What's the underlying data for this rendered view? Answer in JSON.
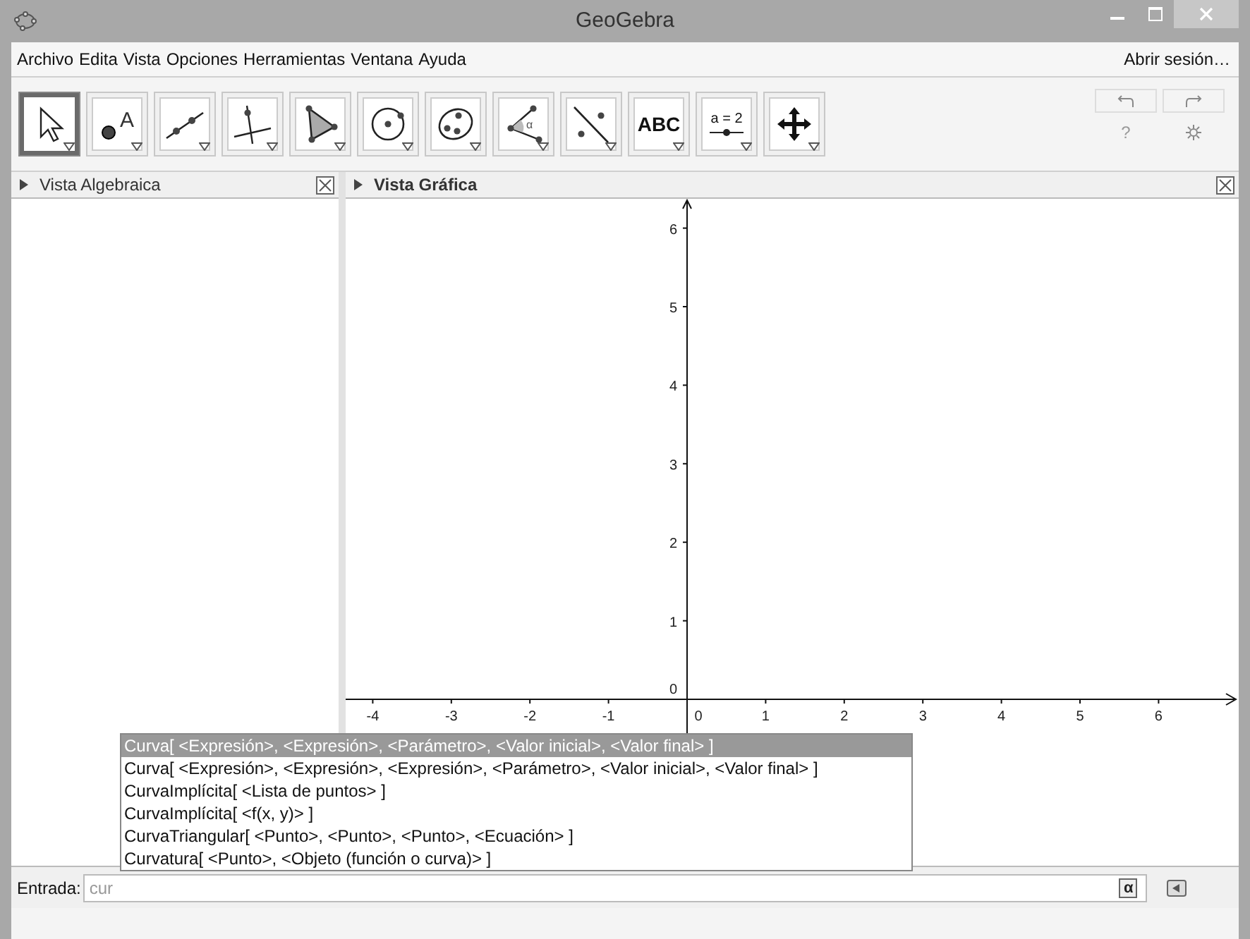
{
  "window": {
    "title": "GeoGebra"
  },
  "menu": [
    "Archivo",
    "Edita",
    "Vista",
    "Opciones",
    "Herramientas",
    "Ventana",
    "Ayuda"
  ],
  "sign_in": "Abrir sesión…",
  "tools": [
    {
      "kind": "move",
      "selected": true
    },
    {
      "kind": "point",
      "label": "A",
      "selected": false
    },
    {
      "kind": "line",
      "selected": false
    },
    {
      "kind": "perpendicular",
      "selected": false
    },
    {
      "kind": "polygon",
      "selected": false
    },
    {
      "kind": "circle",
      "selected": false
    },
    {
      "kind": "conic",
      "selected": false
    },
    {
      "kind": "angle",
      "label": "α",
      "selected": false
    },
    {
      "kind": "reflect",
      "selected": false
    },
    {
      "kind": "text",
      "label": "ABC",
      "selected": false
    },
    {
      "kind": "slider",
      "label": "a = 2",
      "selected": false
    },
    {
      "kind": "pan",
      "selected": false
    }
  ],
  "help": "?",
  "algebra_view": {
    "title": "Vista Algebraica"
  },
  "graphics_view": {
    "title": "Vista Gráfica",
    "x_labels": [
      "-4",
      "-3",
      "-2",
      "-1",
      "0",
      "1",
      "2",
      "3",
      "4",
      "5",
      "6"
    ],
    "y_labels": [
      "6",
      "5",
      "4",
      "3",
      "2",
      "1",
      "0"
    ]
  },
  "suggestions": [
    {
      "text": "Curva[ <Expresión>, <Expresión>, <Parámetro>, <Valor inicial>, <Valor final> ]",
      "selected": true
    },
    {
      "text": "Curva[ <Expresión>, <Expresión>, <Expresión>, <Parámetro>, <Valor inicial>, <Valor final> ]",
      "selected": false
    },
    {
      "text": "CurvaImplícita[ <Lista de puntos> ]",
      "selected": false
    },
    {
      "text": "CurvaImplícita[ <f(x, y)> ]",
      "selected": false
    },
    {
      "text": "CurvaTriangular[ <Punto>, <Punto>, <Punto>, <Ecuación> ]",
      "selected": false
    },
    {
      "text": "Curvatura[ <Punto>, <Objeto (función o curva)> ]",
      "selected": false
    }
  ],
  "input_bar": {
    "label": "Entrada:",
    "value": "cur",
    "symbol": "α"
  }
}
